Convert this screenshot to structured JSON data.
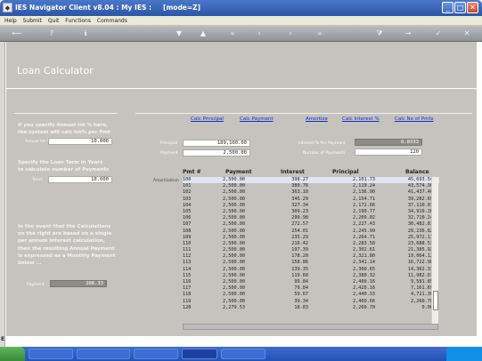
{
  "window": {
    "title": "IES Navigator Client v8.04 : My IES :",
    "mode": "[mode=Z]"
  },
  "menu": [
    "Help",
    "Submit",
    "Quit",
    "Functions",
    "Commands"
  ],
  "page": {
    "title": "Loan Calculator"
  },
  "left": {
    "annual_hint_1": "If you specify Annual Int % here,",
    "annual_hint_2": "the system will calc Int% per Pmt",
    "annual_label": "Annual Int %",
    "annual_value": "10.000",
    "term_hint_1": "Specify the Loan Term in Years",
    "term_hint_2": "to calculate number of Payments",
    "years_label": "Years",
    "years_value": "10.000",
    "note_1": "In the event that the Calculations",
    "note_2": "on the right are based on a single",
    "note_3": "per annum interest calculation,",
    "note_4": "then the resulting Annual Payment",
    "note_5": "is expressed as a Monthly Payment",
    "note_6": "below ...",
    "payment_label": "Payment",
    "payment_value": "208.33"
  },
  "links": {
    "calc_principal": "Calc Principal",
    "calc_payment": "Calc Payment",
    "amortize": "Amortize",
    "calc_interest": "Calc Interest %",
    "calc_no_pmts": "Calc No of Pmts"
  },
  "form": {
    "principal_label": "Principal",
    "principal_value": "189,100.00",
    "payment_label": "Payment",
    "payment_value": "2,500.00",
    "interest_label": "Interest % Per Payment",
    "interest_value": "0.8333",
    "numpay_label": "Number of Payments",
    "numpay_value": "120"
  },
  "table": {
    "label": "Amortization",
    "headers": [
      "Pmt #",
      "Payment",
      "Interest",
      "Principal",
      "Balance"
    ],
    "rows": [
      [
        "100",
        "2,500.00",
        "398.27",
        "2,101.73",
        "45,693.54"
      ],
      [
        "101",
        "2,500.00",
        "380.76",
        "2,119.24",
        "43,574.30"
      ],
      [
        "102",
        "2,500.00",
        "363.10",
        "2,136.90",
        "41,437.40"
      ],
      [
        "103",
        "2,500.00",
        "345.29",
        "2,154.71",
        "39,282.69"
      ],
      [
        "104",
        "2,500.00",
        "327.34",
        "2,172.66",
        "37,110.03"
      ],
      [
        "105",
        "2,500.00",
        "309.23",
        "2,190.77",
        "34,919.26"
      ],
      [
        "106",
        "2,500.00",
        "290.98",
        "2,209.02",
        "32,710.24"
      ],
      [
        "107",
        "2,500.00",
        "272.57",
        "2,227.43",
        "30,482.81"
      ],
      [
        "108",
        "2,500.00",
        "254.01",
        "2,245.99",
        "28,236.82"
      ],
      [
        "109",
        "2,500.00",
        "235.29",
        "2,264.71",
        "25,972.11"
      ],
      [
        "110",
        "2,500.00",
        "216.42",
        "2,283.58",
        "23,688.53"
      ],
      [
        "111",
        "2,500.00",
        "197.39",
        "2,302.61",
        "21,385.92"
      ],
      [
        "112",
        "2,500.00",
        "178.20",
        "2,321.80",
        "19,064.12"
      ],
      [
        "113",
        "2,500.00",
        "158.86",
        "2,341.14",
        "16,722.98"
      ],
      [
        "114",
        "2,500.00",
        "139.35",
        "2,360.65",
        "14,362.33"
      ],
      [
        "115",
        "2,500.00",
        "119.68",
        "2,380.32",
        "11,982.01"
      ],
      [
        "116",
        "2,500.00",
        "99.84",
        "2,400.16",
        "9,581.85"
      ],
      [
        "117",
        "2,500.00",
        "79.84",
        "2,420.16",
        "7,161.69"
      ],
      [
        "118",
        "2,500.00",
        "59.67",
        "2,440.33",
        "4,721.36"
      ],
      [
        "119",
        "2,500.00",
        "39.34",
        "2,460.66",
        "2,260.70"
      ],
      [
        "120",
        "2,279.53",
        "18.83",
        "2,260.70",
        "0.00"
      ]
    ]
  },
  "icons": {
    "toolbar": [
      "back-icon",
      "help-icon",
      "info-icon",
      "down-icon",
      "up-icon",
      "first-icon",
      "prev-icon",
      "next-icon",
      "last-icon",
      "filter-icon",
      "list-icon",
      "forward-icon",
      "confirm-icon",
      "close-icon"
    ]
  }
}
